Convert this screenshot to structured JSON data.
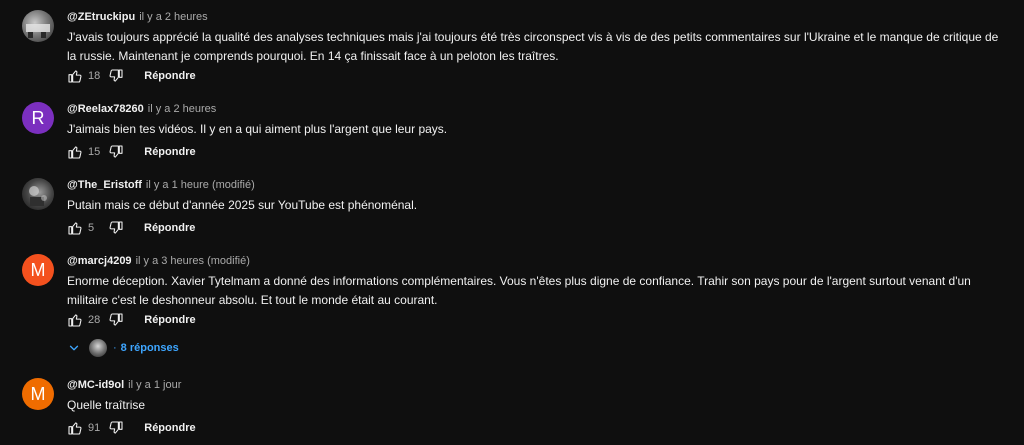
{
  "comments": [
    {
      "author": "@ZEtruckipu",
      "time": "il y a 2 heures",
      "avatar_letter": "",
      "avatar_color": "",
      "text": "J'avais toujours apprécié la qualité des analyses techniques mais j'ai toujours été très circonspect vis à vis de des petits commentaires sur l'Ukraine et le manque de critique de la russie. Maintenant je comprends pourquoi. En 14 ça finissait face à un peloton les traîtres.",
      "likes": "18",
      "reply_label": "Répondre"
    },
    {
      "author": "@Reelax78260",
      "time": "il y a 2 heures",
      "avatar_letter": "R",
      "avatar_color": "#7b2fbf",
      "text": "J'aimais bien tes vidéos. Il y en a qui aiment plus l'argent que leur pays.",
      "likes": "15",
      "reply_label": "Répondre"
    },
    {
      "author": "@The_Eristoff",
      "time": "il y a 1 heure (modifié)",
      "avatar_letter": "",
      "avatar_color": "",
      "text": "Putain mais ce début d'année 2025 sur YouTube est phénoménal.",
      "likes": "5",
      "reply_label": "Répondre"
    },
    {
      "author": "@marcj4209",
      "time": "il y a 3 heures (modifié)",
      "avatar_letter": "M",
      "avatar_color": "#f4511e",
      "text": "Enorme déception. Xavier Tytelmam a donné des informations complémentaires. Vous n'êtes plus digne de confiance. Trahir son pays pour de l'argent surtout venant d'un militaire c'est le deshonneur absolu. Et tout le monde était au courant.",
      "likes": "28",
      "reply_label": "Répondre",
      "replies_label": "8 réponses"
    },
    {
      "author": "@MC-id9ol",
      "time": "il y a 1 jour",
      "avatar_letter": "M",
      "avatar_color": "#ef6c00",
      "text": "Quelle traîtrise",
      "likes": "91",
      "reply_label": "Répondre"
    }
  ],
  "colors": {
    "background": "#0f0f0f",
    "text": "#f1f1f1",
    "secondary_text": "#aaaaaa",
    "link_blue": "#3ea6ff"
  },
  "icons": {
    "like": "thumb-up-icon",
    "dislike": "thumb-down-icon",
    "expand": "chevron-down-icon"
  }
}
